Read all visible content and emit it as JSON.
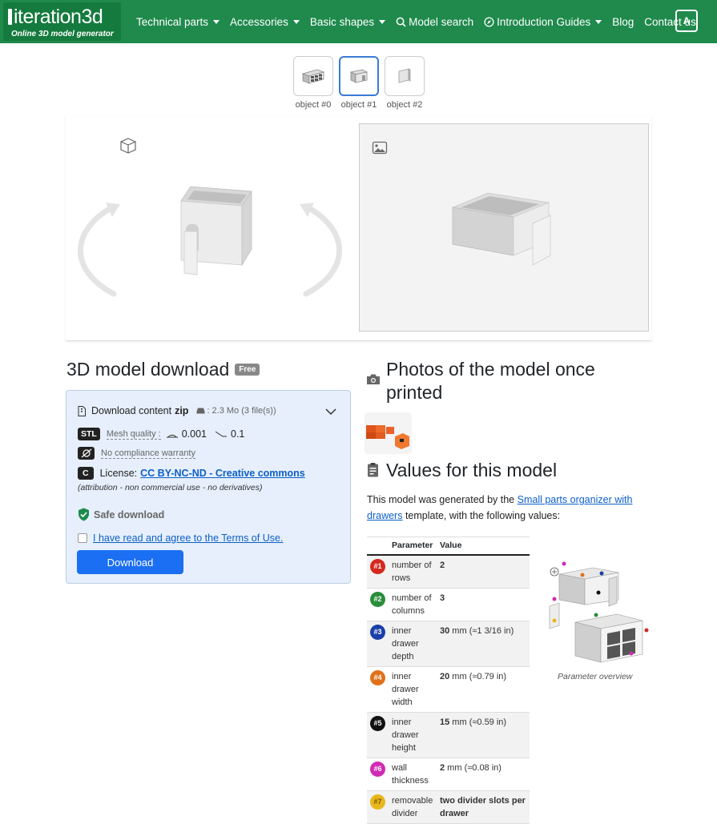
{
  "brand": {
    "name": "iteration3d",
    "tagline": "Online 3D model generator"
  },
  "nav": {
    "technical_parts": "Technical parts",
    "accessories": "Accessories",
    "basic_shapes": "Basic shapes",
    "model_search": "Model search",
    "introduction_guides": "Introduction Guides",
    "blog": "Blog",
    "contact": "Contact us",
    "lang": "A"
  },
  "objects": [
    "object #0",
    "object #1",
    "object #2"
  ],
  "download": {
    "title": "3D model download",
    "badge": "Free",
    "content_label": "Download content",
    "format": "zip",
    "size": ": 2.3 Mo (3 file(s))",
    "stl_tag": "STL",
    "mesh_label": "Mesh quality :",
    "mesh_value_1": "0.001",
    "mesh_value_2": "0.1",
    "no_warranty": "No compliance warranty",
    "license_tag": "C",
    "license_label": "License:",
    "license_name": "CC BY-NC-ND - Creative commons",
    "license_note": "(attribution - non commercial use - no derivatives)",
    "safe": "Safe download",
    "terms": "I have read and agree to the Terms of Use.",
    "button": "Download"
  },
  "photos": {
    "title": "Photos of the model once printed"
  },
  "values": {
    "title": "Values for this model",
    "intro_1": "This model was generated by the",
    "template_link": "Small parts organizer with drawers",
    "intro_2": "template, with the following values:",
    "col_param": "Parameter",
    "col_value": "Value",
    "rows": [
      {
        "num": "#1",
        "color": "#d42a1f",
        "param": "number of rows",
        "value_bold": "2",
        "value_rest": ""
      },
      {
        "num": "#2",
        "color": "#2a8d3a",
        "param": "number of columns",
        "value_bold": "3",
        "value_rest": ""
      },
      {
        "num": "#3",
        "color": "#1b3fa8",
        "param": "inner drawer depth",
        "value_bold": "30",
        "value_rest": " mm (≈1 3/16 in)"
      },
      {
        "num": "#4",
        "color": "#e0711b",
        "param": "inner drawer width",
        "value_bold": "20",
        "value_rest": " mm (≈0.79 in)"
      },
      {
        "num": "#5",
        "color": "#111111",
        "param": "inner drawer height",
        "value_bold": "15",
        "value_rest": " mm (≈0.59 in)"
      },
      {
        "num": "#6",
        "color": "#d12ab3",
        "param": "wall thickness",
        "value_bold": "2",
        "value_rest": " mm (≈0.08 in)"
      },
      {
        "num": "#7",
        "color": "#e8b71c",
        "param": "removable divider",
        "value_bold": "two divider slots per drawer",
        "value_rest": ""
      }
    ],
    "overview_caption": "Parameter overview"
  }
}
